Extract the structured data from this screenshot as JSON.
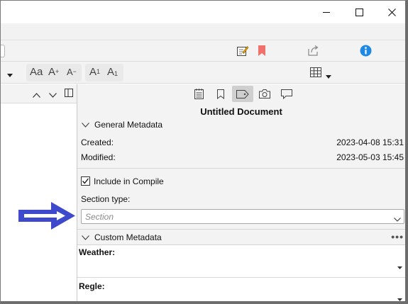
{
  "window": {
    "minimize_icon": "minimize-icon",
    "maximize_icon": "maximize-icon",
    "close_icon": "close-icon"
  },
  "toolbar": {
    "icons": [
      "edit-note-icon",
      "bookmark-icon",
      "share-icon",
      "info-icon"
    ],
    "colors": {
      "bookmark": "#f0716c",
      "info": "#1e88e5",
      "edit": "#e3a300"
    }
  },
  "format_toolbar": {
    "font_case": "Aa",
    "grow_base": "A",
    "grow_sign": "+",
    "shrink_base": "A",
    "shrink_sign": "−",
    "super_base": "A",
    "super_mark": "1",
    "sub_base": "A",
    "sub_mark": "1"
  },
  "inspector": {
    "title": "Untitled Document",
    "active_tab": "metadata-tab",
    "general_section": "General Metadata",
    "created_label": "Created:",
    "created_value": "2023-04-08 15:31",
    "modified_label": "Modified:",
    "modified_value": "2023-05-03 15:45",
    "include_compile_label": "Include in Compile",
    "include_compile_checked": true,
    "section_type_label": "Section type:",
    "section_type_placeholder": "Section",
    "custom_section": "Custom Metadata",
    "more_label": "•••",
    "custom_fields": [
      {
        "label": "Weather:"
      },
      {
        "label": "Regle:"
      }
    ]
  },
  "annotation": {
    "arrow_color": "#3e49cc"
  }
}
